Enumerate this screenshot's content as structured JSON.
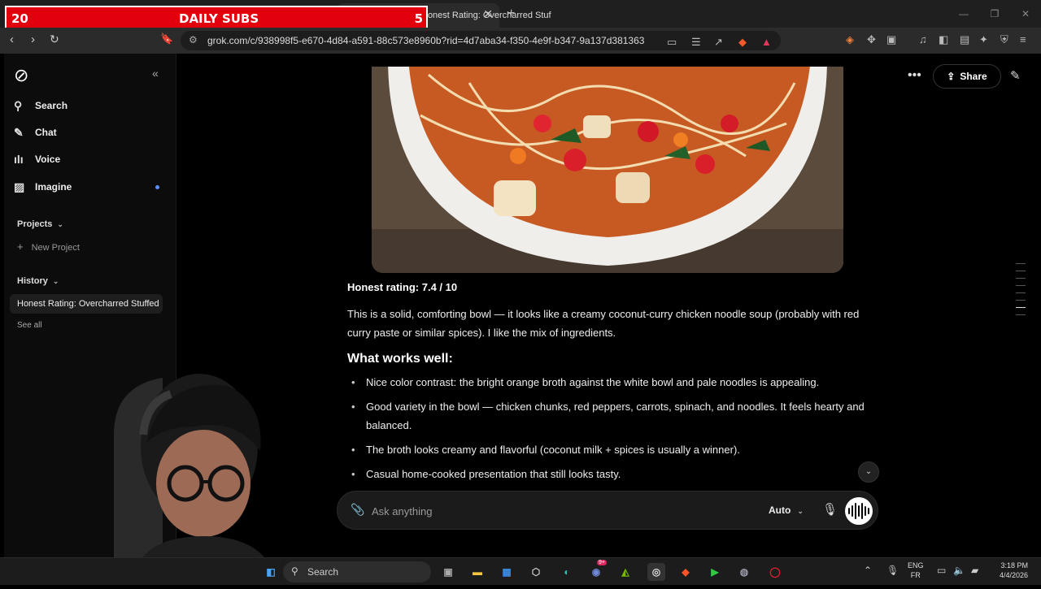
{
  "overlay": {
    "left_num": "20",
    "title": "DAILY SUBS",
    "right_num": "5"
  },
  "browser": {
    "tab_title": "Honest Rating: Overcharred Stuf",
    "url": "grok.com/c/938998f5-e670-4d84-a591-88c573e8960b?rid=4d7aba34-f350-4e9f-b347-9a137d381363"
  },
  "sidebar": {
    "nav": [
      {
        "label": "Search",
        "icon": "search-icon"
      },
      {
        "label": "Chat",
        "icon": "chat-icon"
      },
      {
        "label": "Voice",
        "icon": "voice-wave-icon"
      },
      {
        "label": "Imagine",
        "icon": "image-icon"
      }
    ],
    "projects_label": "Projects",
    "new_project_label": "New Project",
    "history_label": "History",
    "history_items": [
      "Honest Rating: Overcharred Stuffed"
    ],
    "see_all_label": "See all"
  },
  "header": {
    "share_label": "Share"
  },
  "article": {
    "rating": "Honest rating: 7.4 / 10",
    "intro": "This is a solid, comforting bowl — it looks like a creamy coconut-curry chicken noodle soup (probably with red curry paste or similar spices). I like the mix of ingredients.",
    "works_title": "What works well:",
    "bullets": [
      "Nice color contrast: the bright orange broth against the white bowl and pale noodles is appealing.",
      "Good variety in the bowl — chicken chunks, red peppers, carrots, spinach, and noodles. It feels hearty and balanced.",
      "The broth looks creamy and flavorful (coconut milk + spices is usually a winner).",
      "Casual home-cooked presentation that still looks tasty."
    ]
  },
  "composer": {
    "placeholder": "Ask anything",
    "model": "Auto"
  },
  "taskbar": {
    "search_label": "Search",
    "discord_badge": "9+",
    "lang_top": "ENG",
    "lang_bottom": "FR",
    "time": "3:18 PM",
    "date": "4/4/2026"
  }
}
